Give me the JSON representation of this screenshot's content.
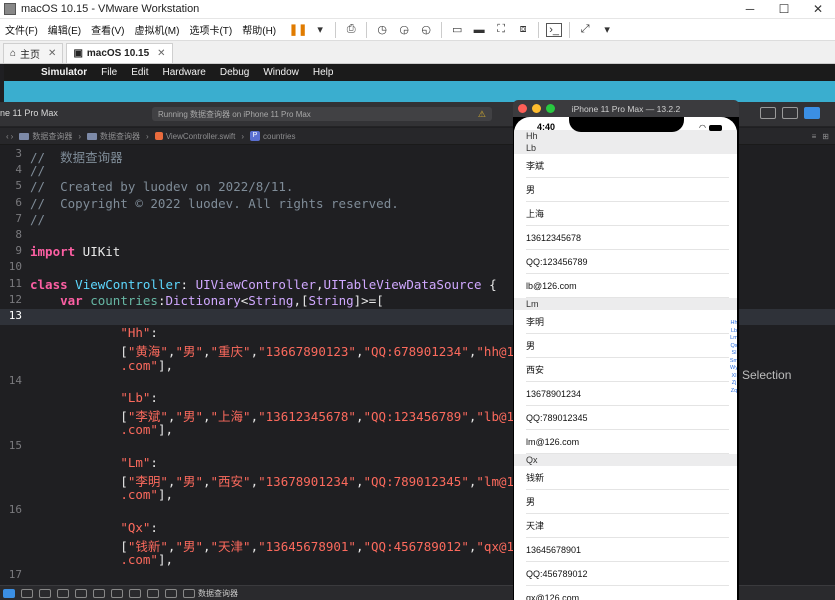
{
  "vmware": {
    "title": "macOS 10.15 - VMware Workstation",
    "menu": [
      "文件(F)",
      "编辑(E)",
      "查看(V)",
      "虚拟机(M)",
      "选项卡(T)",
      "帮助(H)"
    ],
    "tabs": [
      {
        "label": "主页",
        "active": false
      },
      {
        "label": "macOS 10.15",
        "active": true
      }
    ]
  },
  "mac_menu": [
    "Simulator",
    "File",
    "Edit",
    "Hardware",
    "Debug",
    "Window",
    "Help"
  ],
  "xcode": {
    "scheme": "ne 11 Pro Max",
    "activity": "Running 数据查询器 on iPhone 11 Pro Max",
    "jumpbar": [
      "数据查询器",
      "数据查询器",
      "ViewController.swift",
      "countries"
    ],
    "bottom_target": "数据查询器",
    "inspector_placeholder": "Selection",
    "current_line": "13"
  },
  "code_lines": [
    {
      "n": "3",
      "html": "<span class=\"cm\">//  数据查询器</span>"
    },
    {
      "n": "4",
      "html": "<span class=\"cm\">//</span>"
    },
    {
      "n": "5",
      "html": "<span class=\"cm\">//  Created by luodev on 2022/8/11.</span>"
    },
    {
      "n": "6",
      "html": "<span class=\"cm\">//  Copyright © 2022 luodev. All rights reserved.</span>"
    },
    {
      "n": "7",
      "html": "<span class=\"cm\">//</span>"
    },
    {
      "n": "8",
      "html": ""
    },
    {
      "n": "9",
      "html": "<span class=\"kw\">import</span> UIKit"
    },
    {
      "n": "10",
      "html": ""
    },
    {
      "n": "11",
      "html": "<span class=\"kw\">class</span> <span class=\"ty\">ViewController</span>: <span class=\"ty2\">UIViewController</span>,<span class=\"ty2\">UITableViewDataSource</span> {"
    },
    {
      "n": "12",
      "html": "    <span class=\"kw\">var</span> <span class=\"id\">countries</span>:<span class=\"ty2\">Dictionary</span>&lt;<span class=\"ty2\">String</span>,[<span class=\"ty2\">String</span>]&gt;=["
    },
    {
      "n": "13",
      "html": ""
    },
    {
      "n": "",
      "html": "            <span class=\"str\">\"Hh\"</span>:"
    },
    {
      "n": "",
      "html": "            [<span class=\"str\">\"黄海\"</span>,<span class=\"str\">\"男\"</span>,<span class=\"str\">\"重庆\"</span>,<span class=\"str\">\"13667890123\"</span>,<span class=\"str\">\"QQ:678901234\"</span>,<span class=\"str\">\"hh@126</span>"
    },
    {
      "n": "",
      "html": "            <span class=\"str\">.com\"</span>],"
    },
    {
      "n": "14",
      "html": ""
    },
    {
      "n": "",
      "html": "            <span class=\"str\">\"Lb\"</span>:"
    },
    {
      "n": "",
      "html": "            [<span class=\"str\">\"李斌\"</span>,<span class=\"str\">\"男\"</span>,<span class=\"str\">\"上海\"</span>,<span class=\"str\">\"13612345678\"</span>,<span class=\"str\">\"QQ:123456789\"</span>,<span class=\"str\">\"lb@126</span>"
    },
    {
      "n": "",
      "html": "            <span class=\"str\">.com\"</span>],"
    },
    {
      "n": "15",
      "html": ""
    },
    {
      "n": "",
      "html": "            <span class=\"str\">\"Lm\"</span>:"
    },
    {
      "n": "",
      "html": "            [<span class=\"str\">\"李明\"</span>,<span class=\"str\">\"男\"</span>,<span class=\"str\">\"西安\"</span>,<span class=\"str\">\"13678901234\"</span>,<span class=\"str\">\"QQ:789012345\"</span>,<span class=\"str\">\"lm@126</span>"
    },
    {
      "n": "",
      "html": "            <span class=\"str\">.com\"</span>],"
    },
    {
      "n": "16",
      "html": ""
    },
    {
      "n": "",
      "html": "            <span class=\"str\">\"Qx\"</span>:"
    },
    {
      "n": "",
      "html": "            [<span class=\"str\">\"钱新\"</span>,<span class=\"str\">\"男\"</span>,<span class=\"str\">\"天津\"</span>,<span class=\"str\">\"13645678901\"</span>,<span class=\"str\">\"QQ:456789012\"</span>,<span class=\"str\">\"qx@126</span>"
    },
    {
      "n": "",
      "html": "            <span class=\"str\">.com\"</span>],"
    },
    {
      "n": "17",
      "html": ""
    }
  ],
  "simulator": {
    "title": "iPhone 11 Pro Max — 13.2.2",
    "time": "4:40",
    "sections": [
      {
        "header": "Hh",
        "rows": []
      },
      {
        "header": "Lb",
        "rows": [
          "李斌",
          "男",
          "上海",
          "13612345678",
          "QQ:123456789",
          "lb@126.com"
        ]
      },
      {
        "header": "Lm",
        "rows": [
          "李明",
          "男",
          "西安",
          "13678901234",
          "QQ:789012345",
          "lm@126.com"
        ]
      },
      {
        "header": "Qx",
        "rows": [
          "钱新",
          "男",
          "天津",
          "13645678901",
          "QQ:456789012",
          "qx@126.com"
        ]
      }
    ],
    "index_titles": [
      "Hh",
      "Lb",
      "Lm",
      "Qx",
      "Sl",
      "Sm",
      "Wy",
      "Xl",
      "Zj",
      "Zq"
    ]
  }
}
